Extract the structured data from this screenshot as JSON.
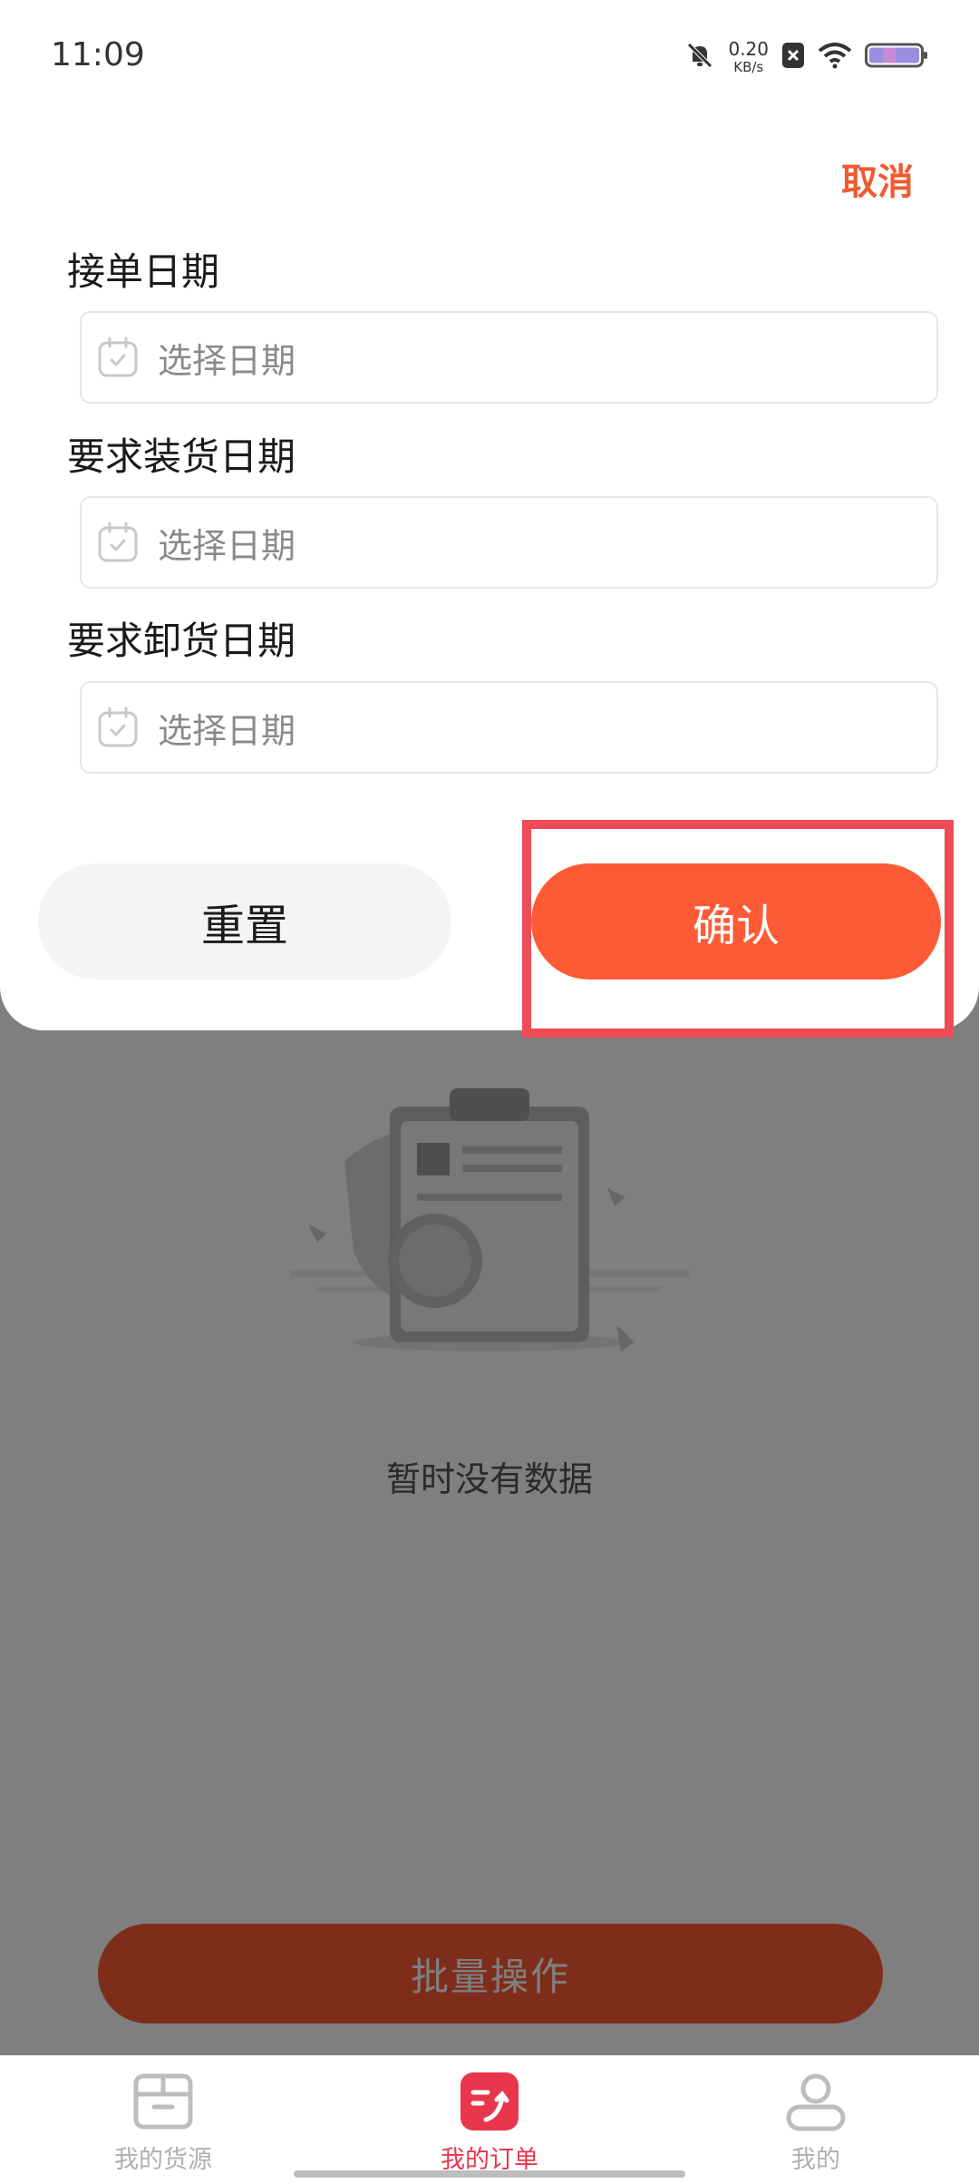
{
  "status_bar": {
    "time": "11:09",
    "speed_value": "0.20",
    "speed_unit": "KB/s"
  },
  "filter": {
    "cancel_label": "取消",
    "fields": [
      {
        "label": "接单日期",
        "placeholder": "选择日期"
      },
      {
        "label": "要求装货日期",
        "placeholder": "选择日期"
      },
      {
        "label": "要求卸货日期",
        "placeholder": "选择日期"
      }
    ],
    "reset_label": "重置",
    "confirm_label": "确认"
  },
  "main": {
    "empty_text": "暂时没有数据",
    "batch_label": "批量操作"
  },
  "bottom_nav": {
    "items": [
      {
        "label": "我的货源",
        "icon": "box-icon"
      },
      {
        "label": "我的订单",
        "icon": "order-icon"
      },
      {
        "label": "我的",
        "icon": "user-icon"
      }
    ],
    "active_index": 1
  },
  "colors": {
    "accent": "#ff5a36",
    "cancel": "#f05a30",
    "active_nav": "#e8364c",
    "highlight": "#ee4b55"
  }
}
